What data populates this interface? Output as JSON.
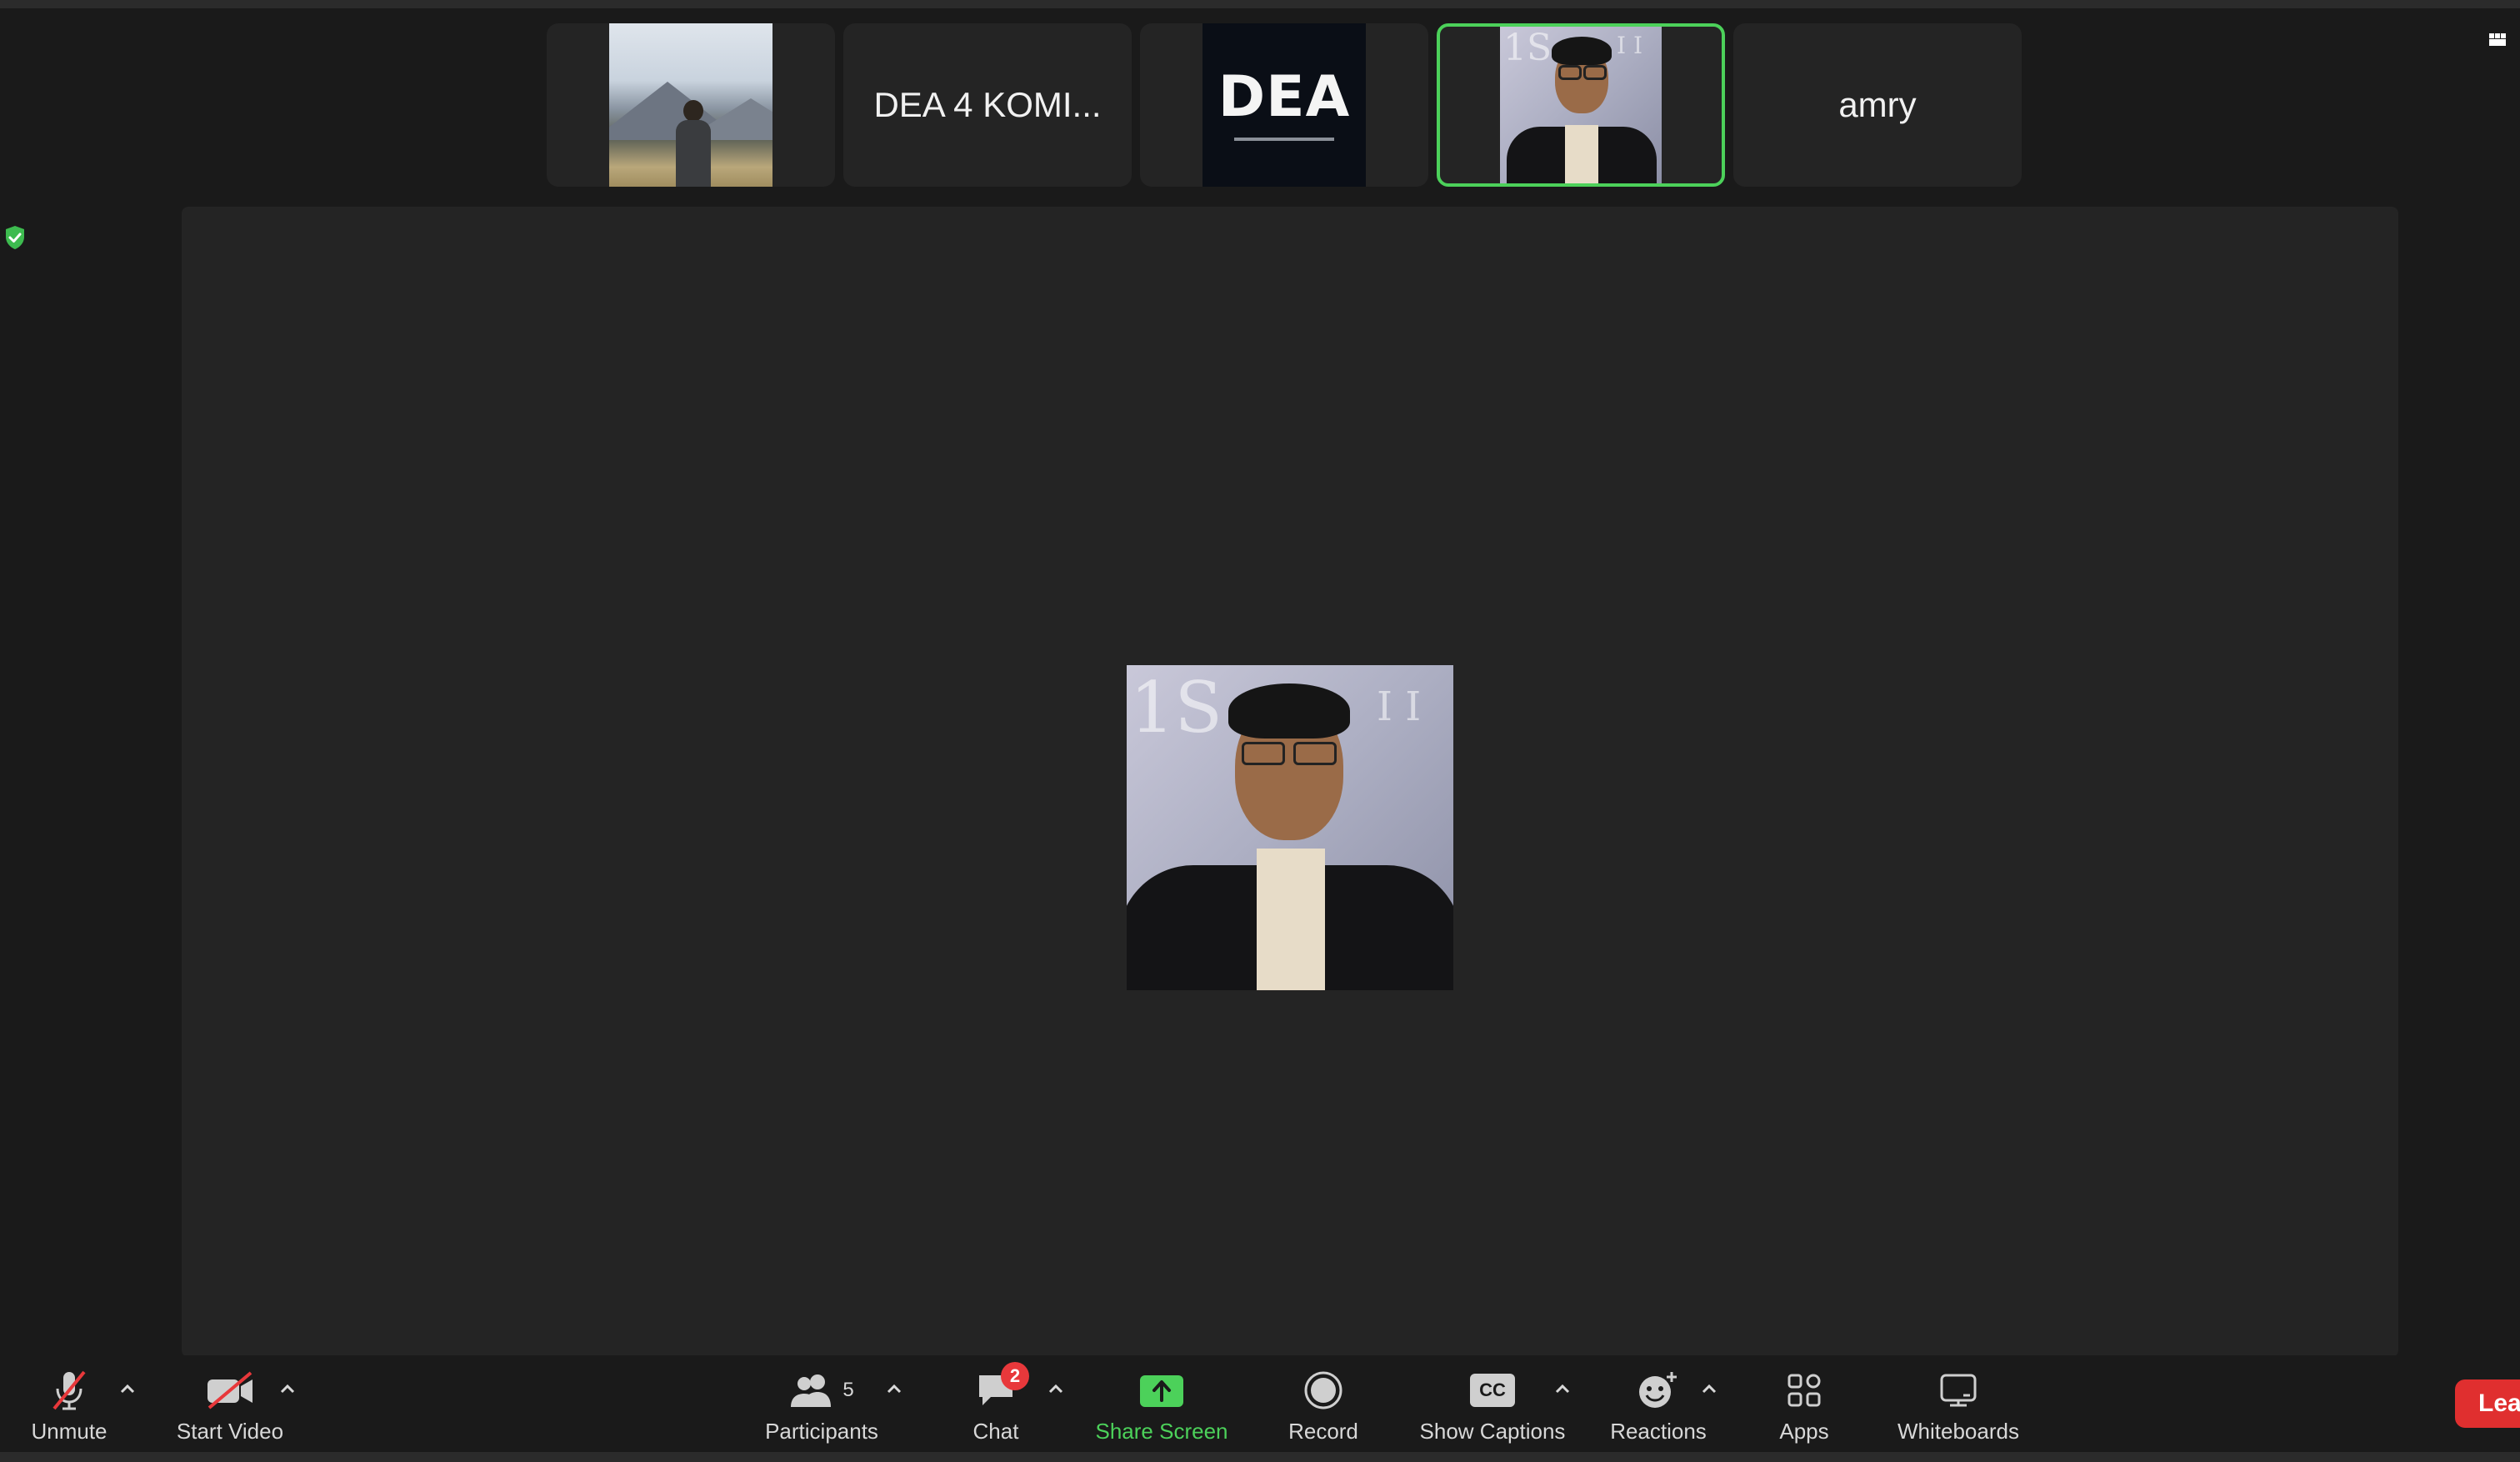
{
  "participants_strip": {
    "tile2_name": "DEA 4 KOMI...",
    "tile3_logo": "DEA",
    "tile5_name": "amry",
    "active_border_color": "#4cd15a"
  },
  "toolbar": {
    "unmute_label": "Unmute",
    "start_video_label": "Start Video",
    "participants_label": "Participants",
    "participants_count": "5",
    "chat_label": "Chat",
    "chat_badge": "2",
    "share_screen_label": "Share Screen",
    "record_label": "Record",
    "show_captions_label": "Show Captions",
    "captions_icon_text": "CC",
    "reactions_label": "Reactions",
    "apps_label": "Apps",
    "whiteboards_label": "Whiteboards",
    "leave_label": "Lea"
  },
  "icons": {
    "security": "shield-check-icon",
    "view": "gallery-view-icon",
    "mic": "mic-muted-icon",
    "video": "video-off-icon",
    "participants": "people-icon",
    "chat": "chat-bubble-icon",
    "share": "share-screen-icon",
    "record": "record-icon",
    "captions": "cc-icon",
    "reactions": "emoji-plus-icon",
    "apps": "apps-icon",
    "whiteboards": "whiteboard-icon"
  },
  "colors": {
    "accent_green": "#4cd15a",
    "leave_red": "#e02f2f",
    "badge_red": "#e8383b"
  }
}
